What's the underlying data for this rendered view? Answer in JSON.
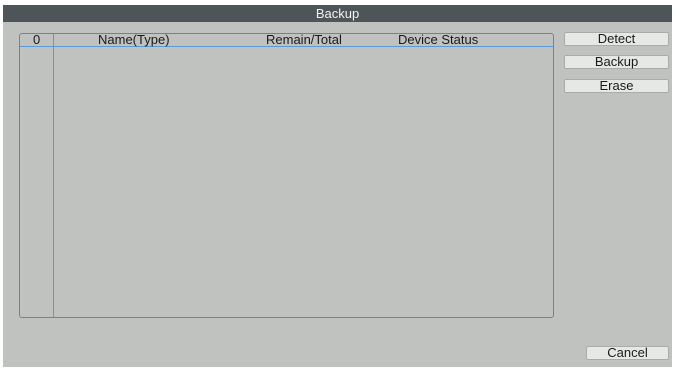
{
  "dialog": {
    "title": "Backup"
  },
  "table": {
    "headers": {
      "index": "0",
      "name_type": "Name(Type)",
      "remain_total": "Remain/Total",
      "device_status": "Device Status"
    },
    "rows": []
  },
  "buttons": {
    "detect": "Detect",
    "backup": "Backup",
    "erase": "Erase",
    "cancel": "Cancel"
  },
  "colors": {
    "titlebar": "#4e5558",
    "panel": "#c0c2c0",
    "grid_line": "#5b9bd5",
    "button_face": "#e6e8e6"
  }
}
